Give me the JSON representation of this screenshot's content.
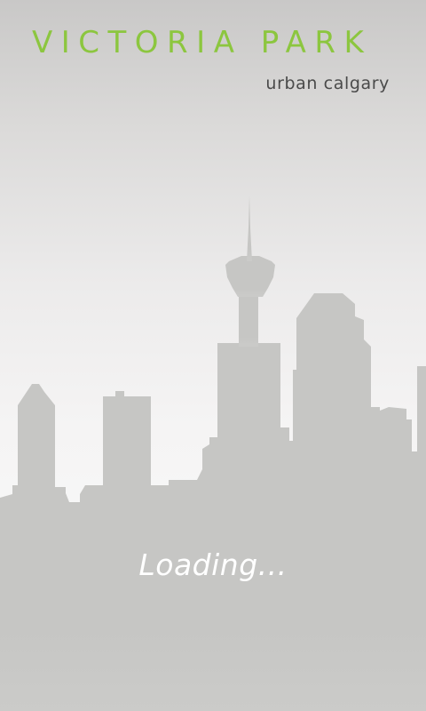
{
  "brand": {
    "title": "VICTORIA PARK",
    "subtitle": "urban calgary"
  },
  "status": {
    "loading_text": "Loading..."
  },
  "colors": {
    "brand_green": "#8cc63f",
    "skyline_gray": "#c6c6c4",
    "subtitle_text": "#4a4a4a",
    "loading_text": "#ffffff"
  }
}
